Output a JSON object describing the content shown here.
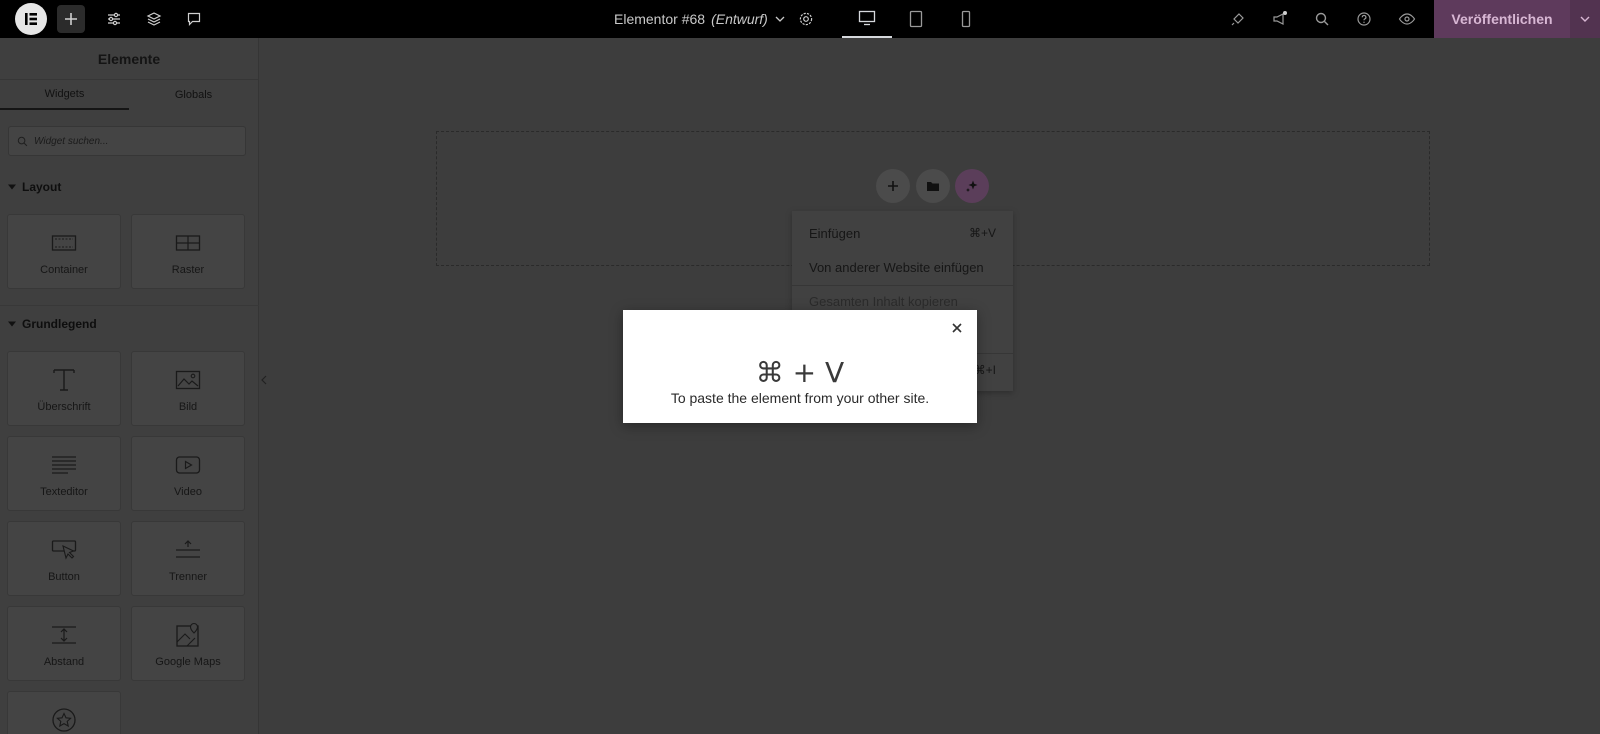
{
  "topbar": {
    "doc_name": "Elementor #68",
    "doc_status": "(Entwurf)",
    "publish_label": "Veröffentlichen"
  },
  "panel": {
    "title": "Elemente",
    "tabs": [
      "Widgets",
      "Globals"
    ],
    "active_tab": "Widgets",
    "search_placeholder": "Widget suchen...",
    "sections": [
      {
        "title": "Layout",
        "widgets": [
          {
            "label": "Container",
            "icon": "container-icon"
          },
          {
            "label": "Raster",
            "icon": "grid-icon"
          }
        ]
      },
      {
        "title": "Grundlegend",
        "widgets": [
          {
            "label": "Überschrift",
            "icon": "heading-icon"
          },
          {
            "label": "Bild",
            "icon": "image-icon"
          },
          {
            "label": "Texteditor",
            "icon": "text-editor-icon"
          },
          {
            "label": "Video",
            "icon": "video-icon"
          },
          {
            "label": "Button",
            "icon": "button-icon"
          },
          {
            "label": "Trenner",
            "icon": "divider-icon"
          },
          {
            "label": "Abstand",
            "icon": "spacer-icon"
          },
          {
            "label": "Google Maps",
            "icon": "google-maps-icon"
          },
          {
            "label": "",
            "icon": "star-icon"
          }
        ]
      }
    ]
  },
  "context_menu": {
    "items": [
      {
        "label": "Einfügen",
        "shortcut": "⌘+V",
        "disabled": false
      },
      {
        "label": "Von anderer Website einfügen",
        "shortcut": "",
        "disabled": false
      },
      {
        "label": "Gesamten Inhalt kopieren",
        "shortcut": "",
        "disabled": true
      },
      {
        "label": "",
        "shortcut": "",
        "disabled": false
      },
      {
        "label": "",
        "shortcut": "⌘+I",
        "disabled": false
      }
    ]
  },
  "modal": {
    "heading": "⌘ + V",
    "text": "To paste the element from your other site."
  },
  "colors": {
    "accent": "#93003f",
    "publish_bg": "#5e3a5c",
    "overlay": "#3d3d3d"
  }
}
